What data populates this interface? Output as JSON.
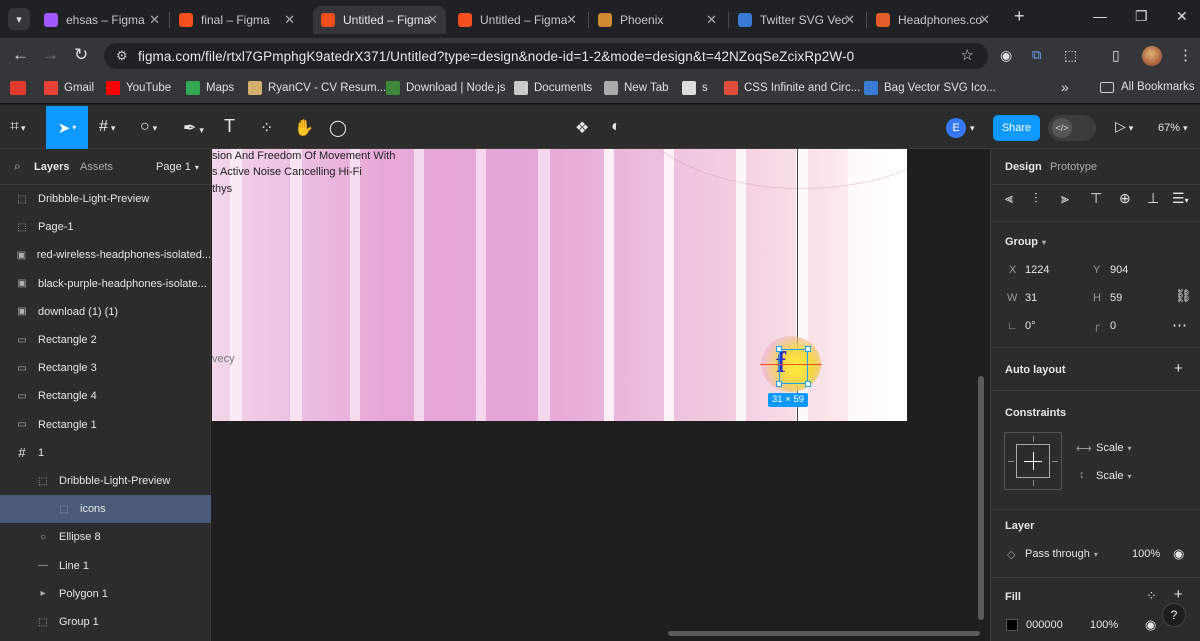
{
  "browser": {
    "tabs": [
      {
        "title": "ehsas – Figma",
        "active": false,
        "color": "#a259ff"
      },
      {
        "title": "final – Figma",
        "active": false,
        "color": "#f24e1e"
      },
      {
        "title": "Untitled – Figma",
        "active": true,
        "color": "#f24e1e"
      },
      {
        "title": "Untitled – Figma",
        "active": false,
        "color": "#f24e1e"
      },
      {
        "title": "Phoenix",
        "active": false,
        "color": "#d08a30"
      },
      {
        "title": "Twitter SVG Vect",
        "active": false,
        "color": "#3a7bd5"
      },
      {
        "title": "Headphones.com",
        "active": false,
        "color": "#e25c2a"
      }
    ],
    "url": "figma.com/file/rtxl7GPmphgK9atedrX371/Untitled?type=design&node-id=1-2&mode=design&t=42NZoqSeZcixRp2W-0",
    "bookmarks": [
      {
        "label": "Gmail",
        "color": "#ea4335"
      },
      {
        "label": "YouTube",
        "color": "#ff0000"
      },
      {
        "label": "Maps",
        "color": "#34a853"
      },
      {
        "label": "RyanCV - CV Resum...",
        "color": "#d4b070"
      },
      {
        "label": "Download | Node.js",
        "color": "#3c873a"
      },
      {
        "label": "Documents",
        "color": "#cccccc"
      },
      {
        "label": "New Tab",
        "color": "#aaaaaa"
      },
      {
        "label": "s",
        "color": "#dddddd"
      },
      {
        "label": "CSS Infinite and Circ...",
        "color": "#e04e39"
      },
      {
        "label": "Bag Vector SVG Ico...",
        "color": "#3a7bd5"
      }
    ],
    "all_bookmarks": "All Bookmarks",
    "more_bookmarks": "»"
  },
  "figma": {
    "toolbar": {
      "share": "Share",
      "zoom": "67%",
      "avatar": "E",
      "code": "</>"
    },
    "left_panel": {
      "tabs": [
        "Layers",
        "Assets"
      ],
      "page": "Page 1",
      "layers": [
        {
          "name": "Dribbble-Light-Preview",
          "icon": "frame-dashed-icon",
          "indent": 0,
          "selected": false
        },
        {
          "name": "Page-1",
          "icon": "frame-dashed-icon",
          "indent": 0,
          "selected": false
        },
        {
          "name": "red-wireless-headphones-isolated...",
          "icon": "image-icon",
          "indent": 0,
          "selected": false
        },
        {
          "name": "black-purple-headphones-isolate...",
          "icon": "image-icon",
          "indent": 0,
          "selected": false
        },
        {
          "name": "download (1) (1)",
          "icon": "image-icon",
          "indent": 0,
          "selected": false
        },
        {
          "name": "Rectangle 2",
          "icon": "rect-icon",
          "indent": 0,
          "selected": false
        },
        {
          "name": "Rectangle 3",
          "icon": "rect-icon",
          "indent": 0,
          "selected": false
        },
        {
          "name": "Rectangle 4",
          "icon": "rect-icon",
          "indent": 0,
          "selected": false
        },
        {
          "name": "Rectangle 1",
          "icon": "rect-icon",
          "indent": 0,
          "selected": false
        },
        {
          "name": "1",
          "icon": "hash-icon",
          "indent": 0,
          "selected": false
        },
        {
          "name": "Dribbble-Light-Preview",
          "icon": "frame-dashed-icon",
          "indent": 1,
          "selected": false
        },
        {
          "name": "icons",
          "icon": "frame-dashed-icon",
          "indent": 2,
          "selected": true
        },
        {
          "name": "Ellipse 8",
          "icon": "ellipse-icon",
          "indent": 1,
          "selected": false
        },
        {
          "name": "Line 1",
          "icon": "line-icon",
          "indent": 1,
          "selected": false
        },
        {
          "name": "Polygon 1",
          "icon": "polygon-icon",
          "indent": 1,
          "selected": false
        },
        {
          "name": "Group 1",
          "icon": "frame-dashed-icon",
          "indent": 1,
          "selected": false
        }
      ]
    },
    "canvas": {
      "text_lines": [
        "sion And Freedom Of Movement With",
        "s Active Noise Cancelling Hi-Fi",
        "thys"
      ],
      "side_text": "vecy",
      "size_badge": "31 × 59"
    },
    "right_panel": {
      "tabs": [
        "Design",
        "Prototype"
      ],
      "group_label": "Group",
      "x_label": "X",
      "x_value": "1224",
      "y_label": "Y",
      "y_value": "904",
      "w_label": "W",
      "w_value": "31",
      "h_label": "H",
      "h_value": "59",
      "rotation": "0°",
      "radius": "0",
      "auto_layout": "Auto layout",
      "constraints": "Constraints",
      "constraint_h": "Scale",
      "constraint_v": "Scale",
      "layer": "Layer",
      "blend": "Pass through",
      "opacity": "100%",
      "fill": "Fill",
      "fill_hex": "000000",
      "fill_opacity": "100%",
      "help": "?"
    }
  }
}
